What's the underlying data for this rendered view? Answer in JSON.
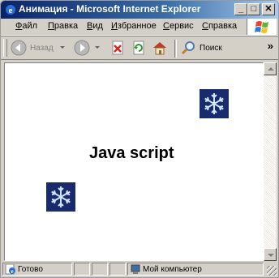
{
  "window": {
    "title": "Анимация - Microsoft Internet Explorer",
    "buttons": {
      "minimize": "_",
      "maximize": "□",
      "close": "✕"
    }
  },
  "menu": {
    "items": [
      "Файл",
      "Правка",
      "Вид",
      "Избранное",
      "Сервис",
      "Справка"
    ]
  },
  "toolbar": {
    "back_label": "Назад",
    "search_label": "Поиск",
    "more": "»"
  },
  "page": {
    "text": "Java script"
  },
  "statusbar": {
    "status": "Готово",
    "zone": "Мой компьютер"
  },
  "colors": {
    "title_start": "#0a246a",
    "snowflake_bg": "#1a2a6e"
  }
}
